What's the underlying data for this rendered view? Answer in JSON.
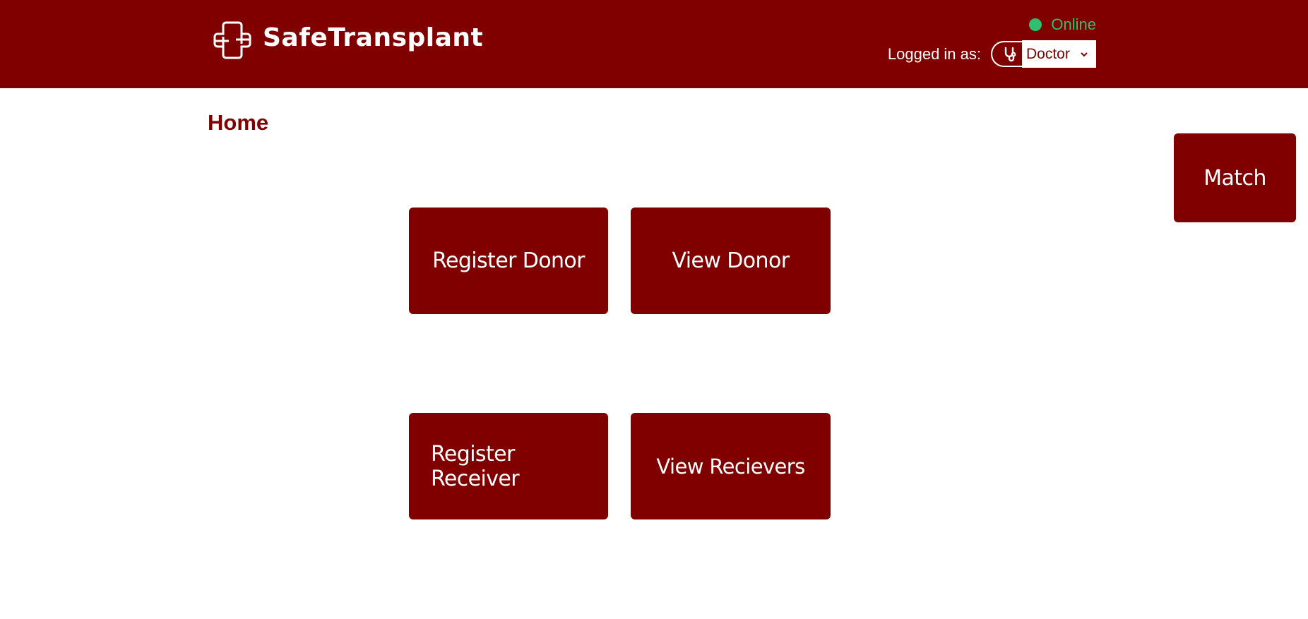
{
  "header": {
    "brand": "SafeTransplant",
    "logo_icon": "medical-cross-icon",
    "status": {
      "text": "Online",
      "color": "#2fbf71"
    },
    "login": {
      "label": "Logged in as:",
      "role_icon": "stethoscope-icon",
      "selected_role": "Doctor",
      "dropdown_icon": "chevron-down-icon"
    }
  },
  "page": {
    "title": "Home"
  },
  "actions": {
    "register_donor": "Register Donor",
    "view_donor": "View Donor",
    "register_receiver_line1": "Register",
    "register_receiver_line2": "Receiver",
    "view_receivers": "View Recievers",
    "match": "Match"
  },
  "colors": {
    "brand": "#800000",
    "background": "#ffffff",
    "online": "#2fbf71",
    "text_on_brand": "#ffffff"
  }
}
